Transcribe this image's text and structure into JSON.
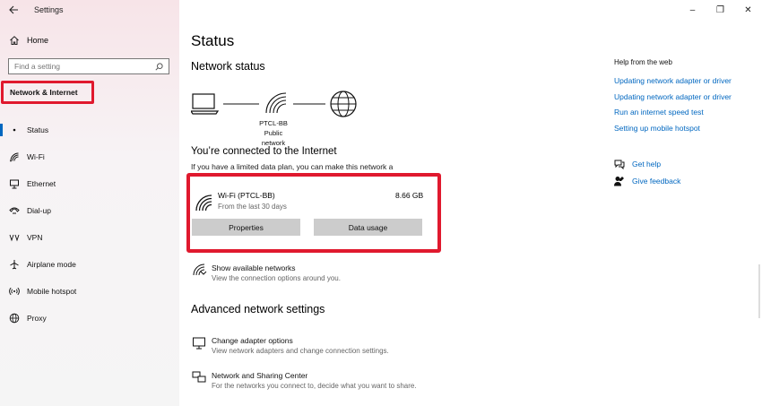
{
  "window": {
    "app_title": "Settings",
    "controls": {
      "minimize": "–",
      "maximize": "❐",
      "close": "✕"
    }
  },
  "sidebar": {
    "home_label": "Home",
    "search_placeholder": "Find a setting",
    "section_title": "Network & Internet",
    "items": [
      {
        "label": "Status",
        "icon": "status-icon"
      },
      {
        "label": "Wi-Fi",
        "icon": "wifi-icon"
      },
      {
        "label": "Ethernet",
        "icon": "ethernet-icon"
      },
      {
        "label": "Dial-up",
        "icon": "dialup-icon"
      },
      {
        "label": "VPN",
        "icon": "vpn-icon"
      },
      {
        "label": "Airplane mode",
        "icon": "airplane-icon"
      },
      {
        "label": "Mobile hotspot",
        "icon": "hotspot-icon"
      },
      {
        "label": "Proxy",
        "icon": "globe-icon"
      }
    ]
  },
  "main": {
    "title": "Status",
    "network_status_heading": "Network status",
    "network": {
      "name": "PTCL-BB",
      "type": "Public network"
    },
    "connected_text": "You’re connected to the Internet",
    "limited_text": "If you have a limited data plan, you can make this network a metered connection or change other properties.",
    "wifi_card": {
      "name": "Wi-Fi (PTCL-BB)",
      "usage": "8.66 GB",
      "period": "From the last 30 days",
      "properties_button": "Properties",
      "data_usage_button": "Data usage"
    },
    "show_networks": {
      "title": "Show available networks",
      "subtitle": "View the connection options around you."
    },
    "advanced_heading": "Advanced network settings",
    "adapter": {
      "title": "Change adapter options",
      "subtitle": "View network adapters and change connection settings."
    },
    "sharing": {
      "title": "Network and Sharing Center",
      "subtitle": "For the networks you connect to, decide what you want to share."
    }
  },
  "right": {
    "help_title": "Help from the web",
    "links": [
      "Updating network adapter or driver",
      "Updating network adapter or driver",
      "Run an internet speed test",
      "Setting up mobile hotspot"
    ],
    "get_help": "Get help",
    "give_feedback": "Give feedback"
  },
  "colors": {
    "accent": "#0067c0",
    "highlight": "#e0192e"
  }
}
